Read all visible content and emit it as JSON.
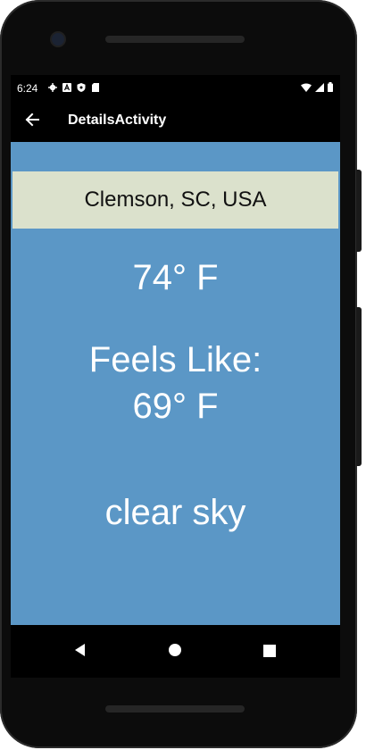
{
  "status_bar": {
    "time": "6:24",
    "left_icons": [
      "settings-icon",
      "font-icon",
      "shield-icon",
      "sd-card-icon"
    ],
    "right_icons": [
      "wifi-icon",
      "signal-icon",
      "battery-icon"
    ]
  },
  "app_bar": {
    "title": "DetailsActivity",
    "back_icon": "arrow-back-icon"
  },
  "weather": {
    "location": "Clemson, SC, USA",
    "temperature": "74° F",
    "feels_like_label": "Feels Like:",
    "feels_like_value": "69° F",
    "condition": "clear sky"
  },
  "nav_bar": {
    "icons": [
      "nav-back-icon",
      "nav-home-icon",
      "nav-recents-icon"
    ]
  },
  "colors": {
    "content_background": "#5b97c6",
    "location_background": "#dbe1cc",
    "app_bar": "#000000"
  }
}
